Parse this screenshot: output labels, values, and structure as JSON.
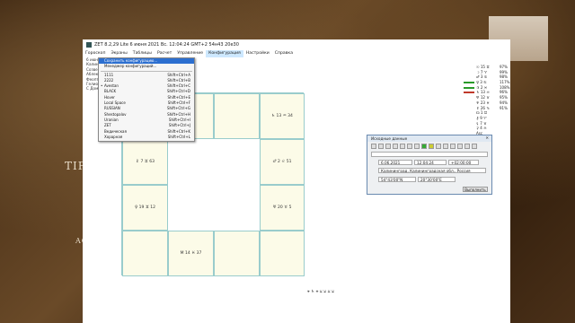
{
  "background": {
    "text_left": "TIF",
    "text_left2": "AC"
  },
  "window": {
    "title": "ZET 8.2,29 Lite     6 июня 2021  Вс.  12:04:24 GMT+2 54н43  20e30",
    "menu": [
      "Гороскоп",
      "Экраны",
      "Таблицы",
      "Расчет",
      "Управление",
      "Конфигурация",
      "Настройки",
      "Справка"
    ],
    "info_lines": [
      "6 июня 2021   Вс  12:04:24 (GMT+2) 54н43  20е30",
      "Калининград, Калининградская обл., Россия",
      "Созвездный: Луна",
      "Аблекекл 24° 8' 6\"",
      "Феоптальния",
      "Гелиоцентрик",
      "С Дом · Знак Кол"
    ]
  },
  "dropdown": {
    "items": [
      {
        "label": "Сохранить конфигурацию...",
        "shortcut": "",
        "highlighted": true
      },
      {
        "label": "Менеджер конфигураций...",
        "shortcut": ""
      },
      {
        "sep": true
      },
      {
        "label": "1111",
        "shortcut": "Shift+Ctrl+A"
      },
      {
        "label": "2222",
        "shortcut": "Shift+Ctrl+B"
      },
      {
        "label": "Avestan",
        "shortcut": "Shift+Ctrl+C",
        "bullet": true
      },
      {
        "label": "BLACK",
        "shortcut": "Shift+Ctrl+D"
      },
      {
        "label": "Hover",
        "shortcut": "Shift+Ctrl+E"
      },
      {
        "label": "Local Space",
        "shortcut": "Shift+Ctrl+F"
      },
      {
        "label": "RUSSIAN",
        "shortcut": "Shift+Ctrl+G"
      },
      {
        "label": "Shestopalov",
        "shortcut": "Shift+Ctrl+H"
      },
      {
        "label": "Uranian",
        "shortcut": "Shift+Ctrl+I"
      },
      {
        "label": "ZET",
        "shortcut": "Shift+Ctrl+J"
      },
      {
        "label": "Ведическая",
        "shortcut": "Shift+Ctrl+K"
      },
      {
        "label": "Хорарная",
        "shortcut": "Shift+Ctrl+L"
      }
    ]
  },
  "chart_cells": [
    "♄ 13 ♒ 34",
    "♇ 7 ♊ 63",
    "♂ 2 ♌ 51",
    "♀ 19 ♊ 12",
    "♅ 20 ♉ 5",
    "M 14 ♓ 37"
  ],
  "right_list": [
    {
      "g": "☉ 15 ♊",
      "v": "97%",
      "c": ""
    },
    {
      "g": "☽ 7 ♈",
      "v": "99%",
      "c": ""
    },
    {
      "g": "♂ 3 ♋",
      "v": "98%",
      "c": ""
    },
    {
      "g": "♀ 3 ♋",
      "v": "117%",
      "c": "#2a9a2a"
    },
    {
      "g": "♃ 2 ♓",
      "v": "108%",
      "c": "#2a9a2a"
    },
    {
      "g": "♄ 13 ♒",
      "v": "96%",
      "c": "#c0392b"
    },
    {
      "g": "♅ 12 ♉",
      "v": "95%",
      "c": ""
    },
    {
      "g": "♆ 23 ♓",
      "v": "94%",
      "c": ""
    },
    {
      "g": "♇ 26 ♑",
      "v": "91%",
      "c": ""
    },
    {
      "g": "☊ 1 ♊",
      "v": "",
      "c": ""
    },
    {
      "g": "⚷ 9 ♈",
      "v": "",
      "c": ""
    },
    {
      "g": "⚸ 7 ♉",
      "v": "",
      "c": ""
    },
    {
      "g": "⚳ 4 ♎",
      "v": "",
      "c": ""
    },
    {
      "g": "Asc",
      "v": "",
      "c": ""
    }
  ],
  "dialog": {
    "title": "Исходные данные",
    "date": "6.06.2021",
    "time": "12:04:24",
    "tz": "+02:00:00",
    "place": "Калининград, Калининградская обл., Россия",
    "lat": "54°43'00\"N",
    "lon": "20°30'00\"E",
    "ok": "Выполнить"
  },
  "bottom_icons": "⚹ ♄ ⚹  ⚺ ⚺ ⚺ ⚺"
}
